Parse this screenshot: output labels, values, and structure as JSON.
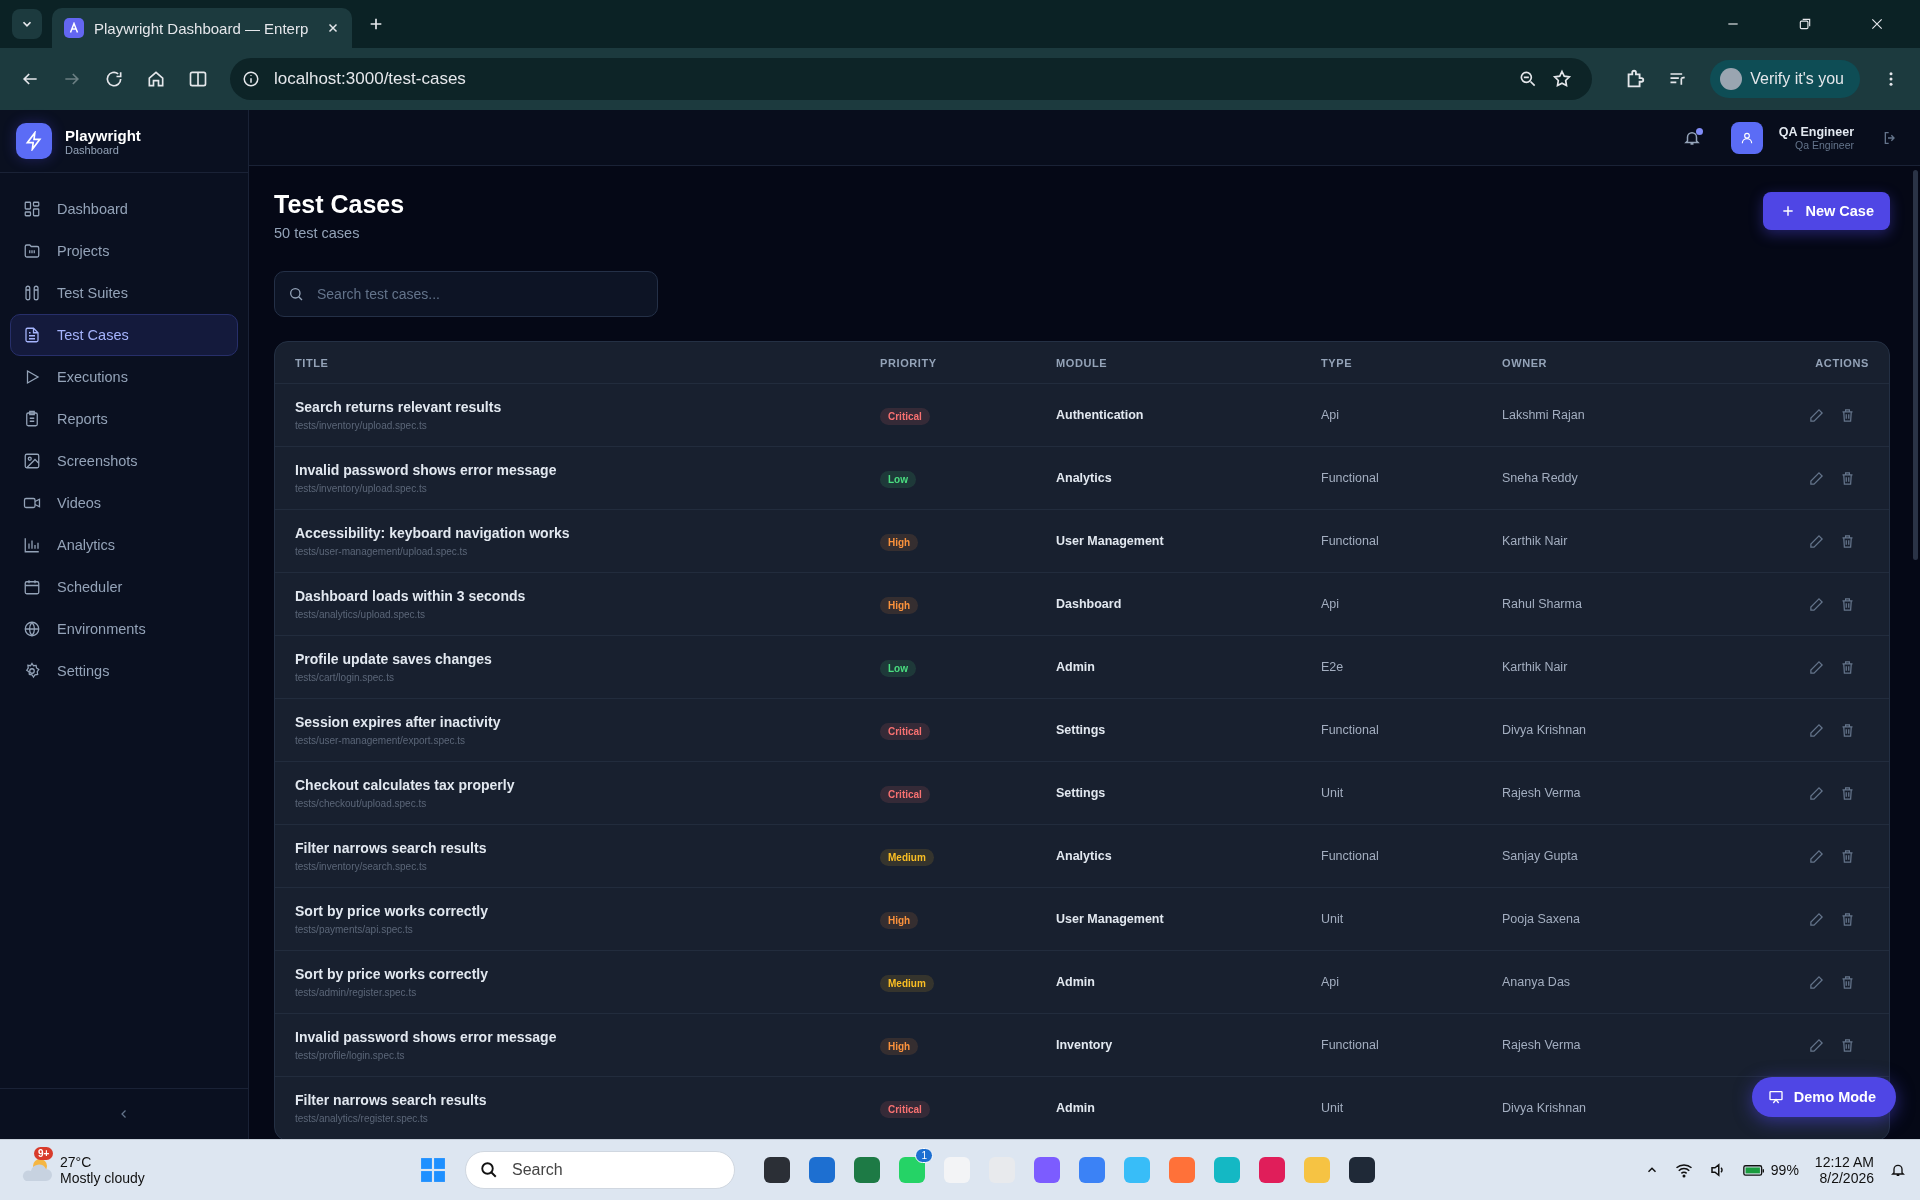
{
  "browser": {
    "tab_title": "Playwright Dashboard — Enterp",
    "url": "localhost:3000/test-cases",
    "profile_button": "Verify it's you"
  },
  "sidebar": {
    "brand": "Playwright",
    "brand_sub": "Dashboard",
    "items": [
      {
        "label": "Dashboard",
        "selected": false
      },
      {
        "label": "Projects",
        "selected": false
      },
      {
        "label": "Test Suites",
        "selected": false
      },
      {
        "label": "Test Cases",
        "selected": true
      },
      {
        "label": "Executions",
        "selected": false
      },
      {
        "label": "Reports",
        "selected": false
      },
      {
        "label": "Screenshots",
        "selected": false
      },
      {
        "label": "Videos",
        "selected": false
      },
      {
        "label": "Analytics",
        "selected": false
      },
      {
        "label": "Scheduler",
        "selected": false
      },
      {
        "label": "Environments",
        "selected": false
      },
      {
        "label": "Settings",
        "selected": false
      }
    ]
  },
  "header": {
    "user_name": "QA Engineer",
    "user_role": "Qa Engineer",
    "notification_unread": true
  },
  "page": {
    "title": "Test Cases",
    "subtitle": "50 test cases",
    "new_button": "New Case",
    "search": {
      "placeholder": "Search test cases..."
    }
  },
  "table": {
    "columns": [
      "TITLE",
      "PRIORITY",
      "MODULE",
      "TYPE",
      "OWNER",
      "ACTIONS"
    ],
    "rows": [
      {
        "title": "Search returns relevant results",
        "path": "tests/inventory/upload.spec.ts",
        "priority": "Critical",
        "color": "#f87171",
        "module": "Authentication",
        "type": "Api",
        "owner": "Lakshmi Rajan"
      },
      {
        "title": "Invalid password shows error message",
        "path": "tests/inventory/upload.spec.ts",
        "priority": "Low",
        "color": "#4ade80",
        "module": "Analytics",
        "type": "Functional",
        "owner": "Sneha Reddy"
      },
      {
        "title": "Accessibility: keyboard navigation works",
        "path": "tests/user-management/upload.spec.ts",
        "priority": "High",
        "color": "#fb923c",
        "module": "User Management",
        "type": "Functional",
        "owner": "Karthik Nair"
      },
      {
        "title": "Dashboard loads within 3 seconds",
        "path": "tests/analytics/upload.spec.ts",
        "priority": "High",
        "color": "#fb923c",
        "module": "Dashboard",
        "type": "Api",
        "owner": "Rahul Sharma"
      },
      {
        "title": "Profile update saves changes",
        "path": "tests/cart/login.spec.ts",
        "priority": "Low",
        "color": "#4ade80",
        "module": "Admin",
        "type": "E2e",
        "owner": "Karthik Nair"
      },
      {
        "title": "Session expires after inactivity",
        "path": "tests/user-management/export.spec.ts",
        "priority": "Critical",
        "color": "#f87171",
        "module": "Settings",
        "type": "Functional",
        "owner": "Divya Krishnan"
      },
      {
        "title": "Checkout calculates tax properly",
        "path": "tests/checkout/upload.spec.ts",
        "priority": "Critical",
        "color": "#f87171",
        "module": "Settings",
        "type": "Unit",
        "owner": "Rajesh Verma"
      },
      {
        "title": "Filter narrows search results",
        "path": "tests/inventory/search.spec.ts",
        "priority": "Medium",
        "color": "#fbbf24",
        "module": "Analytics",
        "type": "Functional",
        "owner": "Sanjay Gupta"
      },
      {
        "title": "Sort by price works correctly",
        "path": "tests/payments/api.spec.ts",
        "priority": "High",
        "color": "#fb923c",
        "module": "User Management",
        "type": "Unit",
        "owner": "Pooja Saxena"
      },
      {
        "title": "Sort by price works correctly",
        "path": "tests/admin/register.spec.ts",
        "priority": "Medium",
        "color": "#fbbf24",
        "module": "Admin",
        "type": "Api",
        "owner": "Ananya Das"
      },
      {
        "title": "Invalid password shows error message",
        "path": "tests/profile/login.spec.ts",
        "priority": "High",
        "color": "#fb923c",
        "module": "Inventory",
        "type": "Functional",
        "owner": "Rajesh Verma"
      },
      {
        "title": "Filter narrows search results",
        "path": "tests/analytics/register.spec.ts",
        "priority": "Critical",
        "color": "#f87171",
        "module": "Admin",
        "type": "Unit",
        "owner": "Divya Krishnan"
      }
    ]
  },
  "demo_button": "Demo Mode",
  "taskbar": {
    "weather_badge": "9+",
    "temperature": "27°C",
    "condition": "Mostly cloudy",
    "search_placeholder": "Search",
    "app_badge": "1",
    "battery": "99%",
    "time": "12:12 AM",
    "date": "8/2/2026"
  }
}
